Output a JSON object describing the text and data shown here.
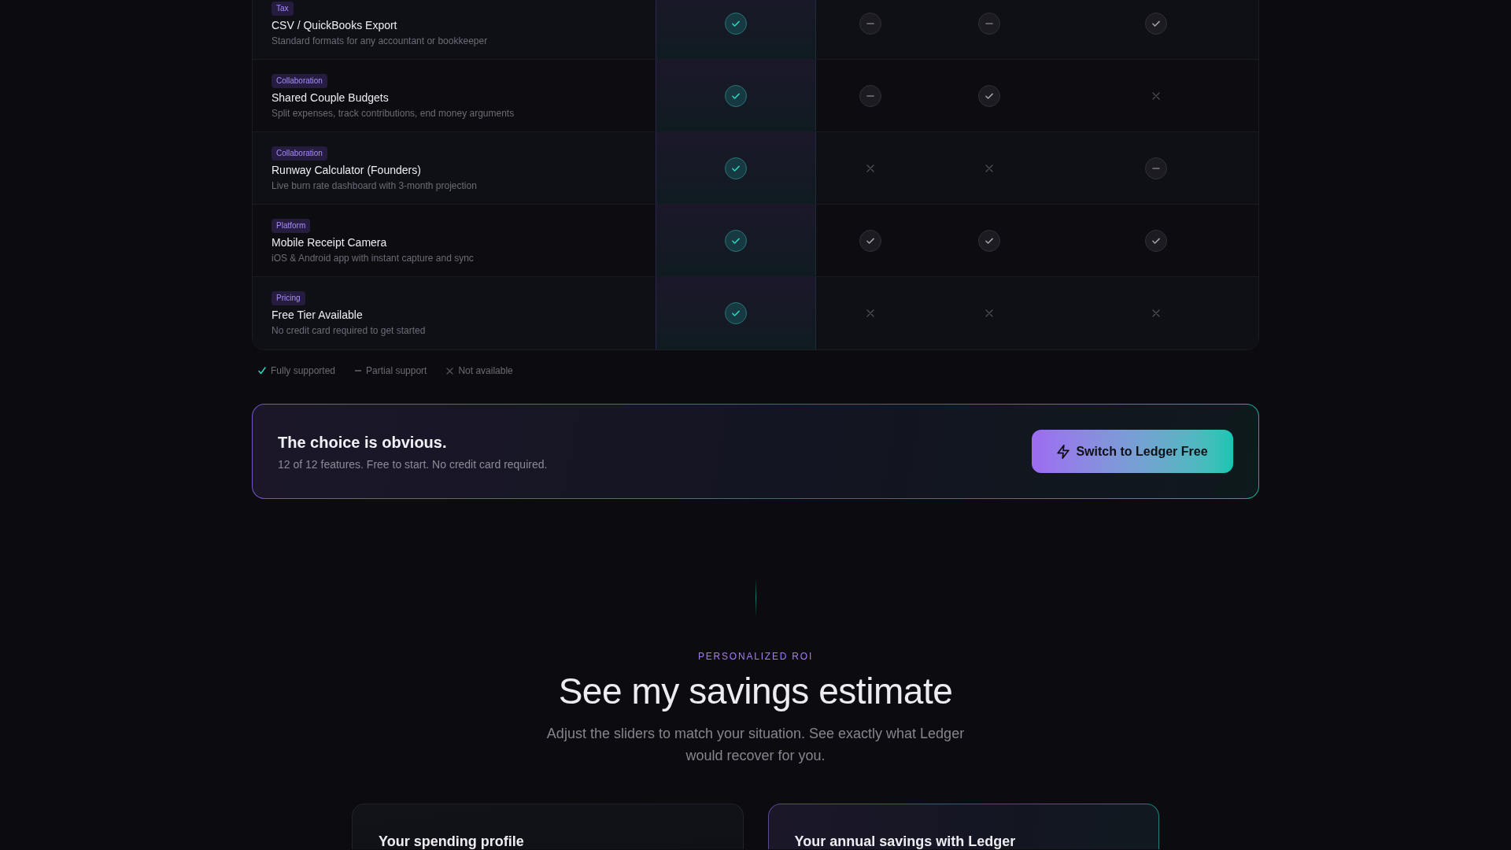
{
  "comparison_table": {
    "columns": [
      {
        "highlighted": true
      },
      {
        "highlighted": false
      },
      {
        "highlighted": false
      },
      {
        "highlighted": false
      }
    ],
    "rows": [
      {
        "tag": "Tax",
        "feature": "CSV / QuickBooks Export",
        "description": "Standard formats for any accountant or bookkeeper",
        "cells": [
          {
            "kind": "full"
          },
          {
            "kind": "partial"
          },
          {
            "kind": "partial"
          },
          {
            "kind": "full"
          }
        ]
      },
      {
        "tag": "Collaboration",
        "feature": "Shared Couple Budgets",
        "description": "Split expenses, track contributions, end money arguments",
        "cells": [
          {
            "kind": "full"
          },
          {
            "kind": "partial"
          },
          {
            "kind": "full"
          },
          {
            "kind": "none"
          }
        ]
      },
      {
        "tag": "Collaboration",
        "feature": "Runway Calculator (Founders)",
        "description": "Live burn rate dashboard with 3-month projection",
        "cells": [
          {
            "kind": "full"
          },
          {
            "kind": "none"
          },
          {
            "kind": "none"
          },
          {
            "kind": "partial"
          }
        ]
      },
      {
        "tag": "Platform",
        "feature": "Mobile Receipt Camera",
        "description": "iOS & Android app with instant capture and sync",
        "cells": [
          {
            "kind": "full"
          },
          {
            "kind": "full"
          },
          {
            "kind": "full"
          },
          {
            "kind": "full"
          }
        ]
      },
      {
        "tag": "Pricing",
        "feature": "Free Tier Available",
        "description": "No credit card required to get started",
        "cells": [
          {
            "kind": "full"
          },
          {
            "kind": "none"
          },
          {
            "kind": "none"
          },
          {
            "kind": "none"
          }
        ]
      }
    ]
  },
  "legend": [
    {
      "kind": "full",
      "label": "Fully supported"
    },
    {
      "kind": "partial",
      "label": "Partial support"
    },
    {
      "kind": "none",
      "label": "Not available"
    }
  ],
  "cta": {
    "title": "The choice is obvious.",
    "text": "12 of 12 features. Free to start. No credit card required.",
    "button": "Switch to Ledger Free"
  },
  "roi": {
    "eyebrow": "PERSONALIZED ROI",
    "heading": "See my savings estimate",
    "subtitle": "Adjust the sliders to match your situation. See exactly what Ledger would recover for you.",
    "cards": [
      {
        "title": "Your spending profile",
        "highlighted": false
      },
      {
        "title": "Your annual savings with Ledger",
        "highlighted": true
      }
    ]
  }
}
